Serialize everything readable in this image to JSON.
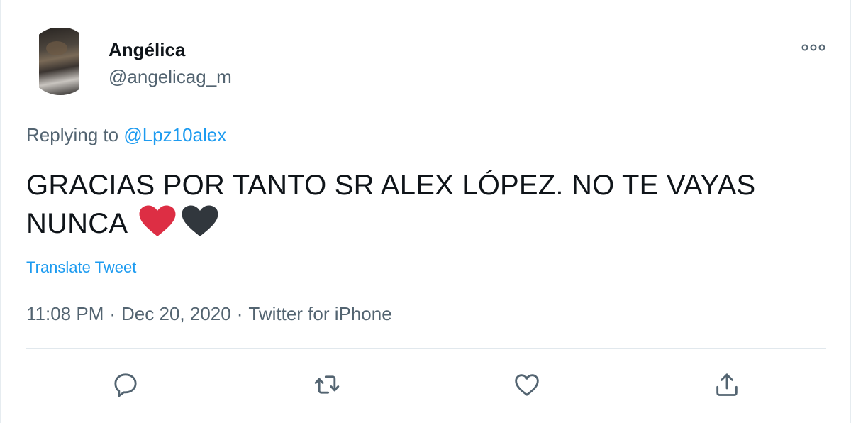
{
  "tweet": {
    "author": {
      "display_name": "Angélica",
      "handle": "@angelicag_m"
    },
    "replying_to": {
      "prefix": "Replying to",
      "mention": "@Lpz10alex"
    },
    "text_line1": "GRACIAS POR TANTO SR ALEX LÓPEZ. NO TE VAYAS",
    "text_line2": "NUNCA",
    "emojis": [
      "red-heart",
      "black-heart"
    ],
    "translate_label": "Translate Tweet",
    "meta": {
      "time": "11:08 PM",
      "date": "Dec 20, 2020",
      "source": "Twitter for iPhone",
      "separator": "·"
    },
    "actions": [
      "reply-icon",
      "retweet-icon",
      "like-icon",
      "share-icon"
    ],
    "colors": {
      "link": "#1d9bf0",
      "muted": "#536471",
      "text": "#0f1419",
      "red_heart": "#dd2e44",
      "black_heart": "#31373d"
    }
  }
}
